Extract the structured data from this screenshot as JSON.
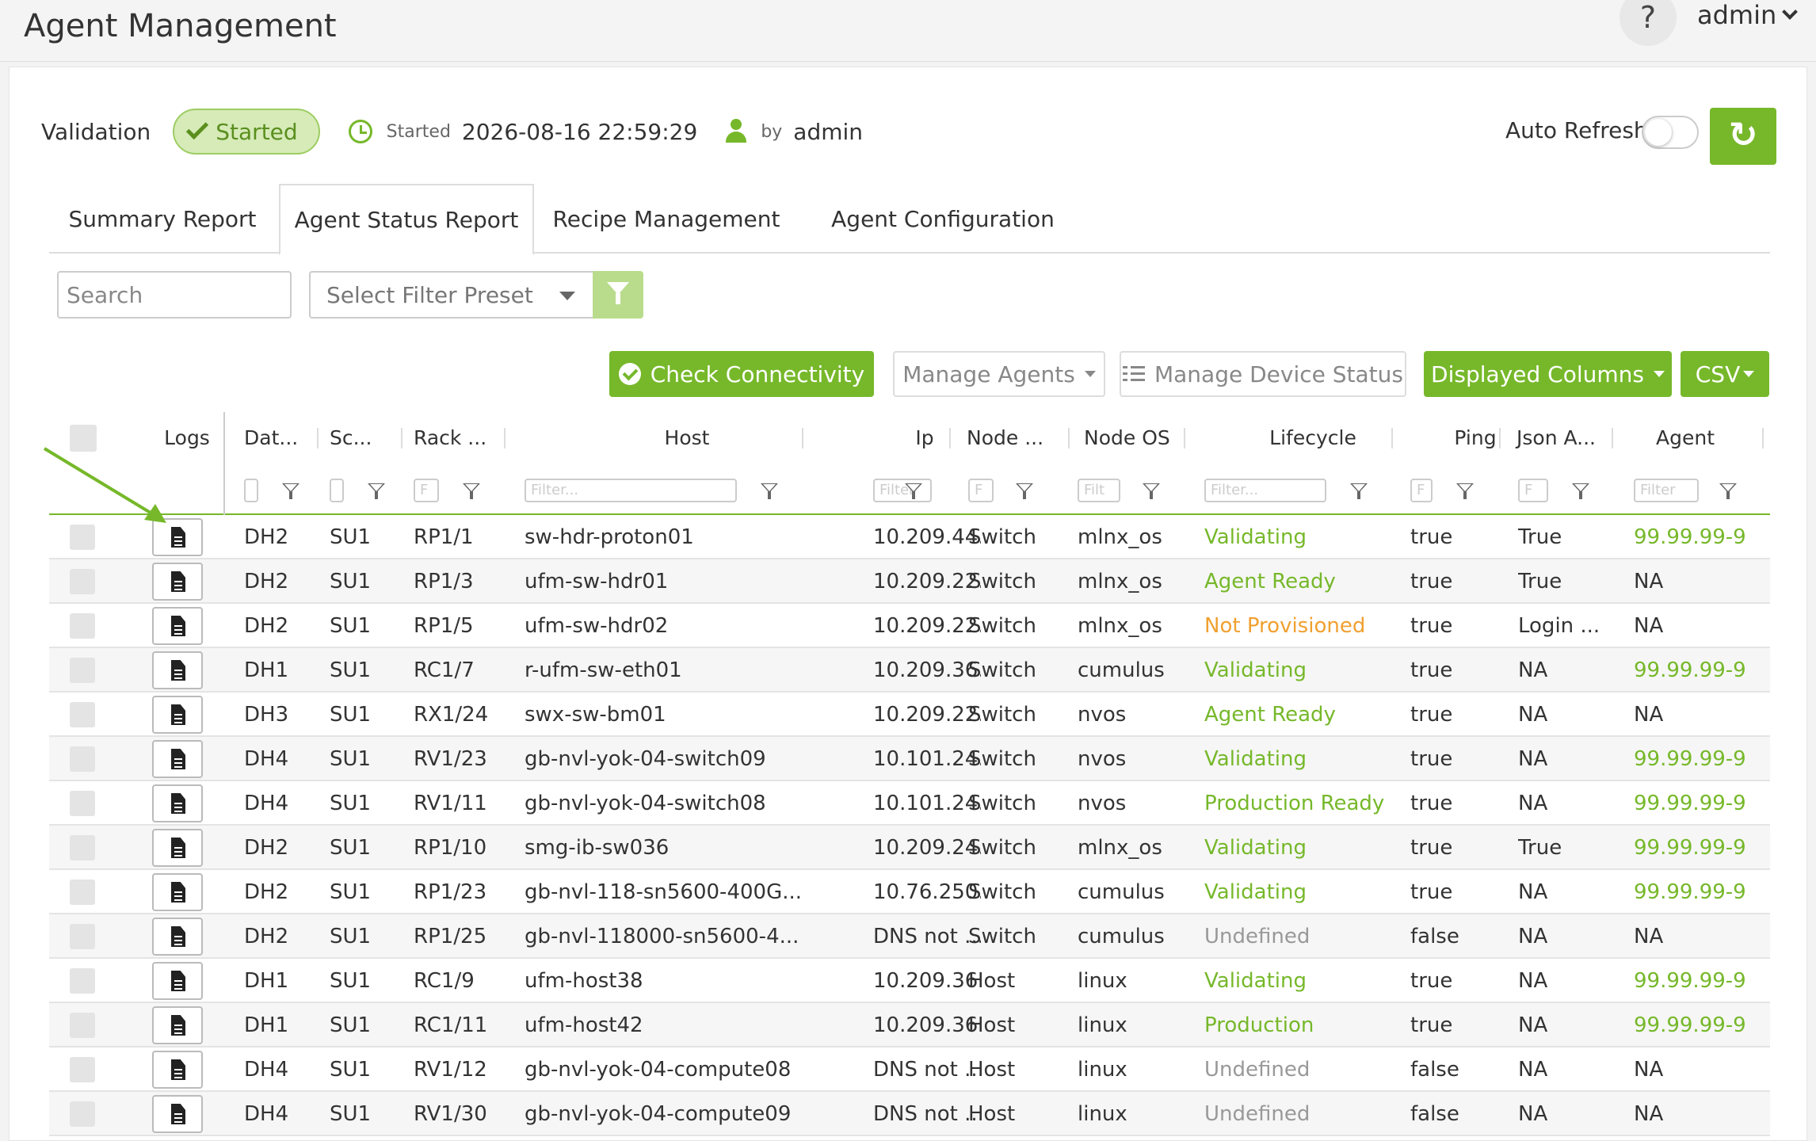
{
  "header": {
    "title": "Agent Management",
    "help": "?",
    "user": "admin"
  },
  "validation": {
    "label": "Validation",
    "status": "Started",
    "started_label": "Started",
    "started_at": "2026-08-16 22:59:29",
    "by_label": "by",
    "by_user": "admin"
  },
  "auto_refresh": {
    "label": "Auto Refresh",
    "enabled": false
  },
  "tabs": [
    {
      "label": "Summary Report",
      "active": false
    },
    {
      "label": "Agent Status Report",
      "active": true
    },
    {
      "label": "Recipe Management",
      "active": false
    },
    {
      "label": "Agent Configuration",
      "active": false
    }
  ],
  "filters": {
    "search_placeholder": "Search",
    "preset_placeholder": "Select Filter Preset"
  },
  "actions": {
    "check": "Check Connectivity",
    "manage_agents": "Manage Agents",
    "manage_device": "Manage Device Status",
    "columns": "Displayed Columns",
    "csv": "CSV"
  },
  "table": {
    "columns": [
      "Logs",
      "Dat...",
      "Sc...",
      "Rack ...",
      "Host",
      "Ip",
      "Node ...",
      "Node OS",
      "Lifecycle",
      "Ping",
      "Json A...",
      "Agent"
    ],
    "filter_placeholders": [
      "",
      "",
      "F",
      "Filter...",
      "Filter",
      "F",
      "Filt",
      "Filter...",
      "F",
      "F",
      "Filter"
    ],
    "rows": [
      [
        "DH2",
        "SU1",
        "RP1/1",
        "sw-hdr-proton01",
        "10.209.44...",
        "Switch",
        "mlnx_os",
        "Validating",
        "true",
        "True",
        "99.99.99-9"
      ],
      [
        "DH2",
        "SU1",
        "RP1/3",
        "ufm-sw-hdr01",
        "10.209.22...",
        "Switch",
        "mlnx_os",
        "Agent Ready",
        "true",
        "True",
        "NA"
      ],
      [
        "DH2",
        "SU1",
        "RP1/5",
        "ufm-sw-hdr02",
        "10.209.22...",
        "Switch",
        "mlnx_os",
        "Not Provisioned",
        "true",
        "Login ...",
        "NA"
      ],
      [
        "DH1",
        "SU1",
        "RC1/7",
        "r-ufm-sw-eth01",
        "10.209.36...",
        "Switch",
        "cumulus",
        "Validating",
        "true",
        "NA",
        "99.99.99-9"
      ],
      [
        "DH3",
        "SU1",
        "RX1/24",
        "swx-sw-bm01",
        "10.209.22...",
        "Switch",
        "nvos",
        "Agent Ready",
        "true",
        "NA",
        "NA"
      ],
      [
        "DH4",
        "SU1",
        "RV1/23",
        "gb-nvl-yok-04-switch09",
        "10.101.24...",
        "Switch",
        "nvos",
        "Validating",
        "true",
        "NA",
        "99.99.99-9"
      ],
      [
        "DH4",
        "SU1",
        "RV1/11",
        "gb-nvl-yok-04-switch08",
        "10.101.24...",
        "Switch",
        "nvos",
        "Production Ready",
        "true",
        "NA",
        "99.99.99-9"
      ],
      [
        "DH2",
        "SU1",
        "RP1/10",
        "smg-ib-sw036",
        "10.209.24...",
        "Switch",
        "mlnx_os",
        "Validating",
        "true",
        "True",
        "99.99.99-9"
      ],
      [
        "DH2",
        "SU1",
        "RP1/23",
        "gb-nvl-118-sn5600-400G...",
        "10.76.250...",
        "Switch",
        "cumulus",
        "Validating",
        "true",
        "NA",
        "99.99.99-9"
      ],
      [
        "DH2",
        "SU1",
        "RP1/25",
        "gb-nvl-118000-sn5600-4...",
        "DNS not ...",
        "Switch",
        "cumulus",
        "Undefined",
        "false",
        "NA",
        "NA"
      ],
      [
        "DH1",
        "SU1",
        "RC1/9",
        "ufm-host38",
        "10.209.36...",
        "Host",
        "linux",
        "Validating",
        "true",
        "NA",
        "99.99.99-9"
      ],
      [
        "DH1",
        "SU1",
        "RC1/11",
        "ufm-host42",
        "10.209.36...",
        "Host",
        "linux",
        "Production",
        "true",
        "NA",
        "99.99.99-9"
      ],
      [
        "DH4",
        "SU1",
        "RV1/12",
        "gb-nvl-yok-04-compute08",
        "DNS not ...",
        "Host",
        "linux",
        "Undefined",
        "false",
        "NA",
        "NA"
      ],
      [
        "DH4",
        "SU1",
        "RV1/30",
        "gb-nvl-yok-04-compute09",
        "DNS not ...",
        "Host",
        "linux",
        "Undefined",
        "false",
        "NA",
        "NA"
      ]
    ]
  },
  "colors": {
    "accent": "#76b82a",
    "warning": "#f0a030",
    "muted": "#999999"
  },
  "icons": {
    "help": "question-icon",
    "refresh": "refresh-icon",
    "logs": "document-icon",
    "filter": "funnel-icon",
    "time": "clock-icon",
    "user": "user-icon"
  }
}
